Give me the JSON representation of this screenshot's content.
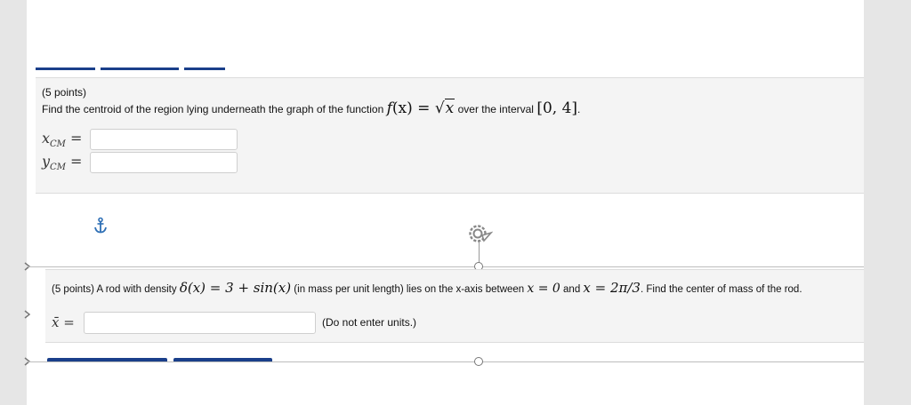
{
  "q1": {
    "points": "(5 points)",
    "text_before": "Find the centroid of the region lying underneath the graph of the function ",
    "func_name": "f",
    "func_arg": "(x)",
    "equals": " = ",
    "sqrt_arg": "x",
    "text_mid": " over the interval ",
    "interval": "[0, 4]",
    "text_end": ".",
    "xcm_var": "x",
    "xcm_sub": "CM",
    "ycm_var": "y",
    "ycm_sub": "CM",
    "eq_sign": " =",
    "xcm_value": "",
    "ycm_value": ""
  },
  "q2": {
    "p1": "(5 points) A rod with density ",
    "density": "δ(x) = 3 + sin(x)",
    "p2": " (in mass per unit length) lies on the x-axis between ",
    "lower": "x = 0",
    "p3": " and ",
    "upper": "x = 2π/3",
    "p4": ". Find the center of mass of the rod.",
    "xbar_label": "x̄ =",
    "xbar_value": "",
    "note": "(Do not enter units.)"
  },
  "icons": {
    "anchor": "anchor-icon",
    "gear": "gear-add-icon"
  },
  "colors": {
    "accent": "#1a3f8a",
    "anchor": "#2e6fb5",
    "panel": "#f4f4f4"
  }
}
